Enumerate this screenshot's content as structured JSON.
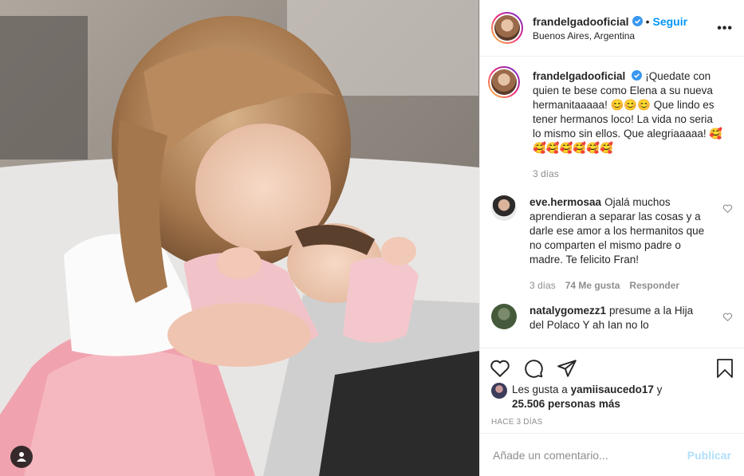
{
  "header": {
    "username": "frandelgadooficial",
    "separator": "•",
    "follow_label": "Seguir",
    "location": "Buenos Aires, Argentina",
    "more_icon": "more-horizontal-icon"
  },
  "caption": {
    "username": "frandelgadooficial",
    "text": "¡Quedate con quien te bese como Elena a su nueva hermanitaaaaa! 😊😊😊 Que lindo es tener hermanos loco! La vida no seria lo mismo sin ellos. Que alegriaaaaa! 🥰🥰🥰🥰🥰🥰🥰",
    "time": "3 días"
  },
  "comments": [
    {
      "username": "eve.hermosaa",
      "text": "Ojalá muchos aprendieran a separar las cosas y a darle ese amor a los hermanitos que no comparten el mismo padre o madre. Te felicito Fran!",
      "time": "3 días",
      "likes": "74 Me gusta",
      "reply": "Responder"
    },
    {
      "username": "natalygomezz1",
      "text": "presume a la Hija del Polaco Y ah Ian no lo"
    }
  ],
  "likes": {
    "prefix": "Les gusta a",
    "user": "yamiisaucedo17",
    "connector": "y",
    "others": "25.506 personas más"
  },
  "time_ago": "HACE 3 DÍAS",
  "add_comment": {
    "placeholder": "Añade un comentario...",
    "publish_label": "Publicar"
  },
  "colors": {
    "accent": "#0095f6",
    "publish_disabled": "#b2dffc",
    "muted": "#8e8e8e",
    "text": "#262626"
  }
}
